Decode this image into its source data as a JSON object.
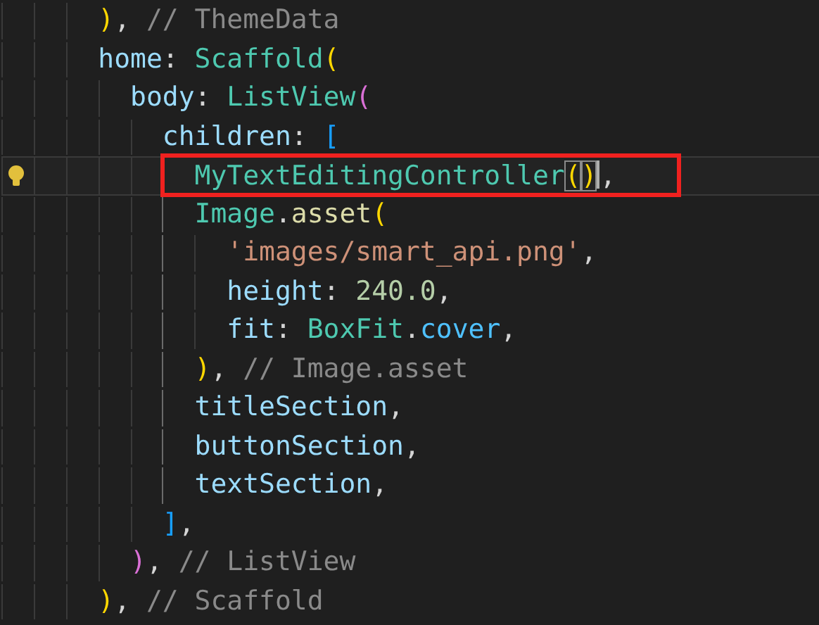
{
  "editor": {
    "lines": [
      {
        "current": false,
        "marked": false,
        "lightbulb": false,
        "tokens": [
          {
            "text": ")",
            "kind": "paren1"
          },
          {
            "text": ", ",
            "kind": "punct"
          },
          {
            "text": "// ThemeData",
            "kind": "comment"
          }
        ]
      },
      {
        "current": false,
        "marked": false,
        "lightbulb": false,
        "tokens": [
          {
            "text": "home",
            "kind": "prop"
          },
          {
            "text": ": ",
            "kind": "punct"
          },
          {
            "text": "Scaffold",
            "kind": "class"
          },
          {
            "text": "(",
            "kind": "paren1"
          }
        ],
        "children": [
          {
            "current": false,
            "marked": false,
            "lightbulb": false,
            "tokens": [
              {
                "text": "body",
                "kind": "prop"
              },
              {
                "text": ": ",
                "kind": "punct"
              },
              {
                "text": "ListView",
                "kind": "class"
              },
              {
                "text": "(",
                "kind": "paren2"
              }
            ],
            "children": [
              {
                "current": false,
                "marked": false,
                "lightbulb": false,
                "tokens": [
                  {
                    "text": "children",
                    "kind": "prop"
                  },
                  {
                    "text": ": ",
                    "kind": "punct"
                  },
                  {
                    "text": "[",
                    "kind": "paren3"
                  }
                ],
                "children": [
                  {
                    "current": true,
                    "marked": true,
                    "lightbulb": true,
                    "tokens": [
                      {
                        "text": "MyTextEditingController",
                        "kind": "class"
                      },
                      {
                        "text": "(",
                        "kind": "paren1"
                      },
                      {
                        "text": ")",
                        "kind": "paren1"
                      },
                      {
                        "text": ",",
                        "kind": "punct"
                      }
                    ]
                  },
                  {
                    "current": false,
                    "marked": false,
                    "lightbulb": false,
                    "tokens": [
                      {
                        "text": "Image",
                        "kind": "class"
                      },
                      {
                        "text": ".",
                        "kind": "punct"
                      },
                      {
                        "text": "asset",
                        "kind": "func"
                      },
                      {
                        "text": "(",
                        "kind": "paren1"
                      }
                    ],
                    "children": [
                      {
                        "current": false,
                        "marked": false,
                        "lightbulb": false,
                        "tokens": [
                          {
                            "text": "'images/smart_api.png'",
                            "kind": "string"
                          },
                          {
                            "text": ",",
                            "kind": "punct"
                          }
                        ]
                      },
                      {
                        "current": false,
                        "marked": false,
                        "lightbulb": false,
                        "tokens": [
                          {
                            "text": "height",
                            "kind": "prop"
                          },
                          {
                            "text": ": ",
                            "kind": "punct"
                          },
                          {
                            "text": "240.0",
                            "kind": "number"
                          },
                          {
                            "text": ",",
                            "kind": "punct"
                          }
                        ]
                      },
                      {
                        "current": false,
                        "marked": false,
                        "lightbulb": false,
                        "tokens": [
                          {
                            "text": "fit",
                            "kind": "prop"
                          },
                          {
                            "text": ": ",
                            "kind": "punct"
                          },
                          {
                            "text": "BoxFit",
                            "kind": "class"
                          },
                          {
                            "text": ".",
                            "kind": "punct"
                          },
                          {
                            "text": "cover",
                            "kind": "const"
                          },
                          {
                            "text": ",",
                            "kind": "punct"
                          }
                        ]
                      }
                    ]
                  },
                  {
                    "current": false,
                    "marked": false,
                    "lightbulb": false,
                    "tokens": [
                      {
                        "text": ")",
                        "kind": "paren1"
                      },
                      {
                        "text": ", ",
                        "kind": "punct"
                      },
                      {
                        "text": "// Image.asset",
                        "kind": "comment"
                      }
                    ]
                  },
                  {
                    "current": false,
                    "marked": false,
                    "lightbulb": false,
                    "tokens": [
                      {
                        "text": "titleSection",
                        "kind": "prop"
                      },
                      {
                        "text": ",",
                        "kind": "punct"
                      }
                    ]
                  },
                  {
                    "current": false,
                    "marked": false,
                    "lightbulb": false,
                    "tokens": [
                      {
                        "text": "buttonSection",
                        "kind": "prop"
                      },
                      {
                        "text": ",",
                        "kind": "punct"
                      }
                    ]
                  },
                  {
                    "current": false,
                    "marked": false,
                    "lightbulb": false,
                    "tokens": [
                      {
                        "text": "textSection",
                        "kind": "prop"
                      },
                      {
                        "text": ",",
                        "kind": "punct"
                      }
                    ]
                  }
                ]
              },
              {
                "current": false,
                "marked": false,
                "lightbulb": false,
                "tokens": [
                  {
                    "text": "]",
                    "kind": "paren3"
                  },
                  {
                    "text": ",",
                    "kind": "punct"
                  }
                ]
              }
            ]
          },
          {
            "current": false,
            "marked": false,
            "lightbulb": false,
            "tokens": [
              {
                "text": ")",
                "kind": "paren2"
              },
              {
                "text": ", ",
                "kind": "punct"
              },
              {
                "text": "// ListView",
                "kind": "comment"
              }
            ]
          }
        ]
      },
      {
        "current": false,
        "marked": false,
        "lightbulb": false,
        "tokens": [
          {
            "text": ")",
            "kind": "paren1"
          },
          {
            "text": ", ",
            "kind": "punct"
          },
          {
            "text": "// Scaffold",
            "kind": "comment"
          }
        ]
      }
    ]
  }
}
